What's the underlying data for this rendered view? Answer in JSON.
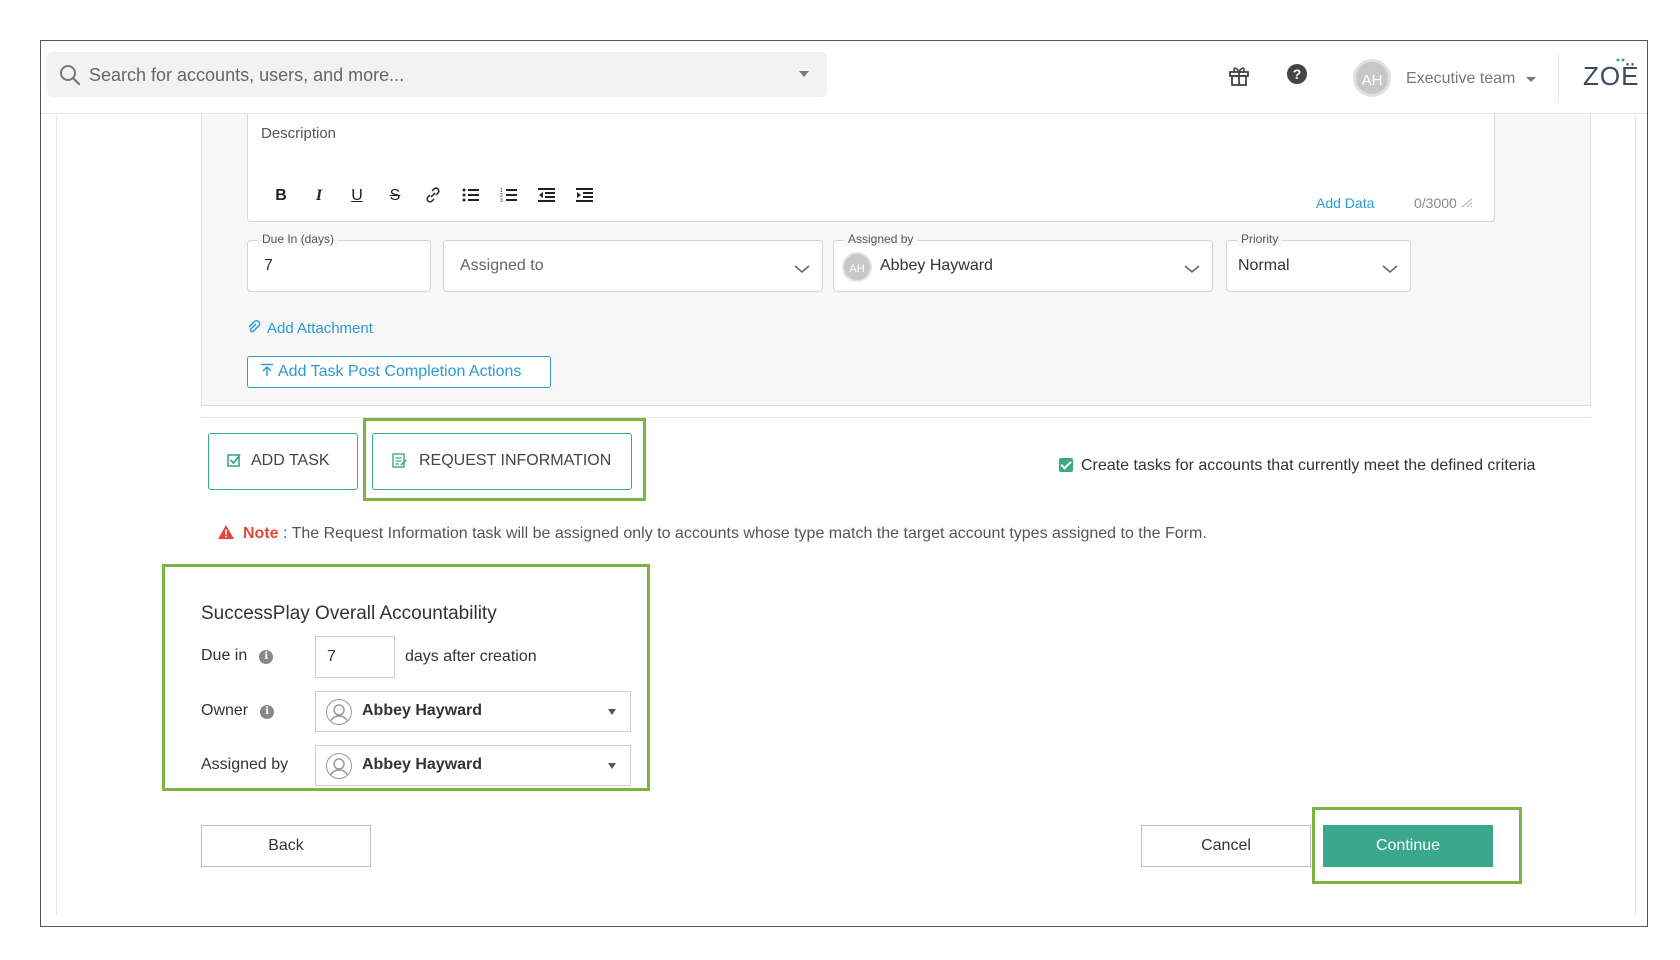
{
  "topbar": {
    "search_placeholder": "Search for accounts, users, and more...",
    "user_initials": "AH",
    "team": "Executive team",
    "logo": "ZOË"
  },
  "task": {
    "description_label": "Description",
    "add_data": "Add Data",
    "char_count": "0/3000",
    "toolbar": [
      "bold",
      "italic",
      "underline",
      "strikethrough",
      "link",
      "bullet-list",
      "numbered-list",
      "outdent",
      "indent"
    ],
    "due_in_label": "Due In (days)",
    "due_in_value": "7",
    "assigned_to_placeholder": "Assigned to",
    "assigned_by_label": "Assigned by",
    "assigned_by_initials": "AH",
    "assigned_by_value": "Abbey Hayward",
    "priority_label": "Priority",
    "priority_value": "Normal",
    "add_attachment": "Add Attachment",
    "post_completion": "Add Task Post Completion Actions"
  },
  "actions": {
    "add_task": "ADD TASK",
    "request_information": "REQUEST INFORMATION",
    "create_tasks_checkbox": "Create tasks for accounts that currently meet the defined criteria",
    "create_tasks_checked": true
  },
  "note": {
    "tag": "Note",
    "text": " : The Request Information task will be assigned only to accounts whose type match the target account types assigned to the Form."
  },
  "accountability": {
    "title": "SuccessPlay Overall Accountability",
    "due_in_label": "Due in",
    "due_in_value": "7",
    "due_in_suffix": "days after creation",
    "owner_label": "Owner",
    "owner_value": "Abbey Hayward",
    "assigned_by_label": "Assigned by",
    "assigned_by_value": "Abbey Hayward"
  },
  "footer": {
    "back": "Back",
    "cancel": "Cancel",
    "continue": "Continue"
  },
  "colors": {
    "accent": "#3aa88a",
    "link": "#2a9bd1",
    "highlight": "#7cb342",
    "warning": "#e04a3b"
  }
}
